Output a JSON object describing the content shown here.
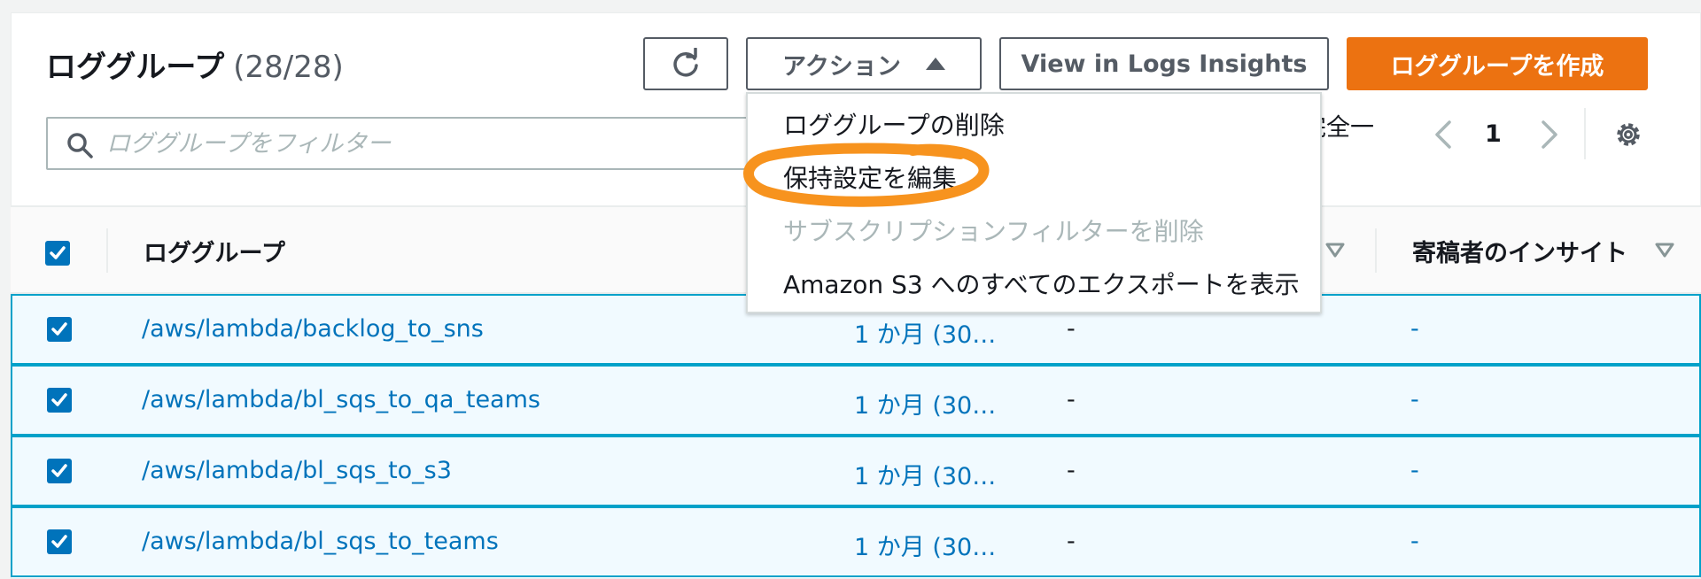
{
  "header": {
    "title": "ロググループ",
    "count": "(28/28)",
    "actions_label": "アクション",
    "insights_label": "View in Logs Insights",
    "create_label": "ロググループを作成"
  },
  "search": {
    "placeholder": "ロググループをフィルター"
  },
  "match_text": "完全一",
  "pagination": {
    "current_page": "1"
  },
  "table": {
    "columns": [
      "ロググループ",
      "寄稿者のインサイト"
    ],
    "rows": [
      {
        "name": "/aws/lambda/backlog_to_sns",
        "retention": "1 か月 (30…",
        "metric": "-",
        "contributor": "-"
      },
      {
        "name": "/aws/lambda/bl_sqs_to_qa_teams",
        "retention": "1 か月 (30…",
        "metric": "-",
        "contributor": "-"
      },
      {
        "name": "/aws/lambda/bl_sqs_to_s3",
        "retention": "1 か月 (30…",
        "metric": "-",
        "contributor": "-"
      },
      {
        "name": "/aws/lambda/bl_sqs_to_teams",
        "retention": "1 か月 (30…",
        "metric": "-",
        "contributor": "-"
      }
    ]
  },
  "actions_menu": {
    "items": [
      {
        "label": "ロググループの削除",
        "disabled": false
      },
      {
        "label": "保持設定を編集",
        "disabled": false
      },
      {
        "label": "サブスクリプションフィルターを削除",
        "disabled": true
      },
      {
        "label": "Amazon S3 へのすべてのエクスポートを表示",
        "disabled": false
      }
    ]
  },
  "colors": {
    "primary_button": "#ec7211",
    "link": "#0073bb",
    "selected_row_bg": "#f1faff",
    "selected_row_border": "#00a1c9",
    "annotation": "#f7931e"
  },
  "icons": {
    "refresh": "refresh-icon",
    "search": "search-icon",
    "settings": "gear-icon",
    "prev": "chevron-left-icon",
    "next": "chevron-right-icon",
    "sort": "sort-caret-icon"
  }
}
